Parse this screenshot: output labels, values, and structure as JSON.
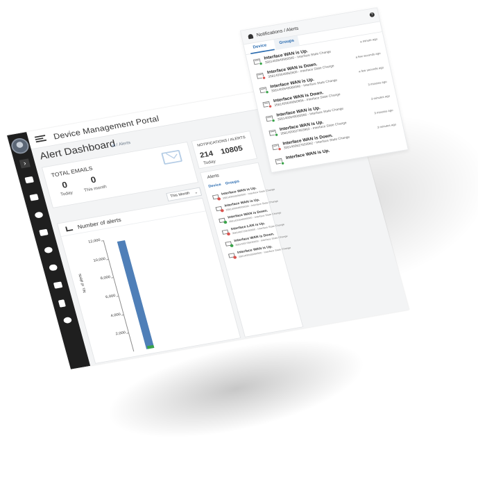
{
  "app": {
    "title": "Device Management Portal"
  },
  "page": {
    "title": "Alert Dashboard",
    "breadcrumb": "/ Alerts"
  },
  "emails": {
    "label": "TOTAL EMAILS",
    "today_value": "0",
    "today_label": "Today",
    "month_value": "0",
    "month_label": "This month"
  },
  "period_select": {
    "value": "This Month"
  },
  "chart_card": {
    "title": "Number of alerts"
  },
  "notifications_card": {
    "label": "NOTIFICATIONS / ALERTS",
    "today_value": "214",
    "today_label": "Today",
    "month_value": "10805"
  },
  "alerts_card": {
    "title": "Alerts",
    "tab_device": "Device",
    "tab_groups": "Groups"
  },
  "mini_alerts": [
    {
      "title": "Interface WAN is Up.",
      "sub": "3581400649960500 - Interface State Change",
      "status": "down"
    },
    {
      "title": "Interface WAN is Up.",
      "sub": "3581400648000000 - Interface State Change",
      "status": "down"
    },
    {
      "title": "Interface WAN is Down.",
      "sub": "3581400648000000 - Interface State Change",
      "status": "up"
    },
    {
      "title": "Interface LAN is Up.",
      "sub": "3581400735030000 - Interface State Change",
      "status": "down"
    },
    {
      "title": "Interface WAN is Down.",
      "sub": "3581400735030000 - Interface State Change",
      "status": "up"
    },
    {
      "title": "Interface WAN is Up.",
      "sub": "3581400649960500 - Interface State Change",
      "status": "down"
    }
  ],
  "chart_data": {
    "type": "bar",
    "title": "Number of alerts",
    "xlabel": "",
    "ylabel": "No. of alerts",
    "ylim": [
      0,
      12000
    ],
    "yticks": [
      "2,000",
      "4,000",
      "6,000",
      "8,000",
      "10,000",
      "12,000"
    ],
    "series": [
      {
        "name": "",
        "values": [
          11600
        ],
        "color": "#4f7fb8"
      },
      {
        "name": "",
        "values": [
          300
        ],
        "color": "#3aa34a"
      }
    ]
  },
  "popup": {
    "title": "Notifications / Alerts",
    "help": "?",
    "tab_device": "Device",
    "tab_groups": "Groups",
    "items": [
      {
        "title": "Interface WAN is Up.",
        "sub": "3581400649960500 - Interface State Change",
        "time": "a minute ago",
        "status": "up"
      },
      {
        "title": "Interface WAN is Down.",
        "sub": "3581400649960500 - Interface State Change",
        "time": "a few seconds ago",
        "status": "down"
      },
      {
        "title": "Interface WAN is Up.",
        "sub": "3581400649060956 - Interface State Change",
        "time": "a few seconds ago",
        "status": "up"
      },
      {
        "title": "Interface WAN is Down.",
        "sub": "3581400649060956 - Interface State Change",
        "time": "3 minutes ago",
        "status": "down"
      },
      {
        "title": "Interface WAN is Up.",
        "sub": "3581400649060956 - Interface State Change",
        "time": "3 minutes ago",
        "status": "up"
      },
      {
        "title": "Interface WAN is Up.",
        "sub": "3581400627603962 - Interface State Change",
        "time": "3 minutes ago",
        "status": "up"
      },
      {
        "title": "Interface WAN is Down.",
        "sub": "3581400627603962 - Interface State Change",
        "time": "3 minutes ago",
        "status": "down"
      },
      {
        "title": "Interface WAN is Up.",
        "sub": "",
        "time": "",
        "status": "up"
      }
    ]
  },
  "colors": {
    "accent": "#2b6cb0",
    "up": "#3aa34a",
    "down": "#d9534f",
    "sidebar": "#1f1f1f"
  }
}
